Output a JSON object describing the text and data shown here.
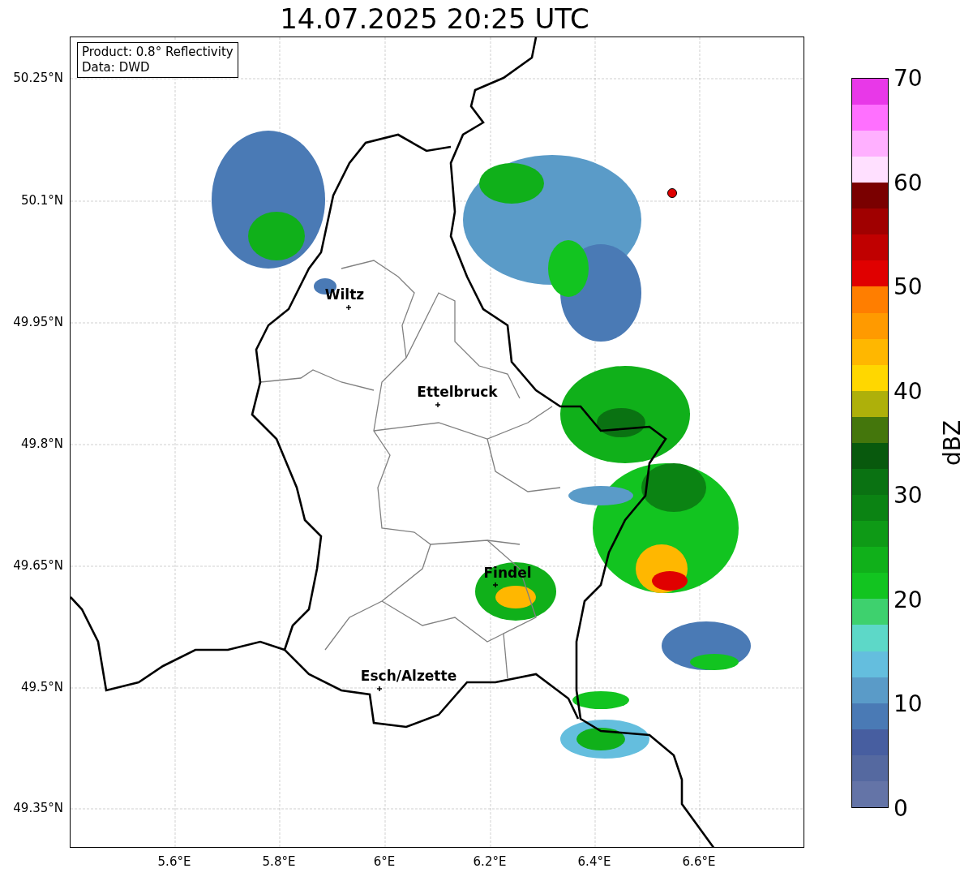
{
  "title": "14.07.2025 20:25 UTC",
  "info_box": [
    "Product: 0.8° Reflectivity",
    "Data: DWD"
  ],
  "map": {
    "lat_ticks": [
      "50.25°N",
      "50.1°N",
      "49.95°N",
      "49.8°N",
      "49.65°N",
      "49.5°N",
      "49.35°N"
    ],
    "lon_ticks": [
      "5.6°E",
      "5.8°E",
      "6°E",
      "6.2°E",
      "6.4°E",
      "6.6°E"
    ],
    "cities": [
      {
        "name": "Wiltz"
      },
      {
        "name": "Ettelbruck"
      },
      {
        "name": "Findel"
      },
      {
        "name": "Esch/Alzette"
      }
    ]
  },
  "colorbar": {
    "label": "dBZ",
    "ticks": [
      "70",
      "60",
      "50",
      "40",
      "30",
      "20",
      "10",
      "0"
    ]
  }
}
